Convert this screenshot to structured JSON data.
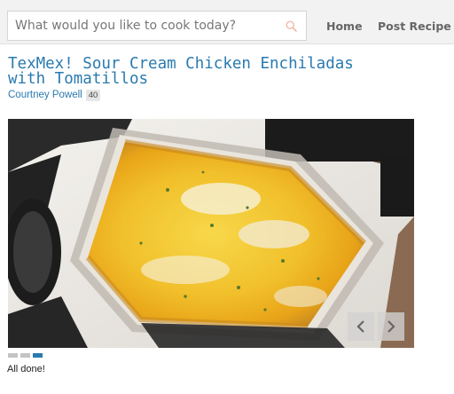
{
  "header": {
    "search": {
      "placeholder": "What would you like to cook today?",
      "value": ""
    },
    "nav": [
      {
        "label": "Home"
      },
      {
        "label": "Post Recipe"
      }
    ]
  },
  "recipe": {
    "title": "TexMex! Sour Cream Chicken Enchiladas with Tomatillos",
    "author": "Courtney Powell",
    "author_count": "40",
    "caption": "All done!"
  },
  "slideshow": {
    "slide_count": 3,
    "current_slide": 3
  },
  "colors": {
    "accent": "#2a7ab0",
    "topbar": "#f2f2f2",
    "badge": "#e6e6e6",
    "dot_inactive": "#c4c4c4"
  },
  "icons": {
    "search": "search-icon",
    "prev": "chevron-left-icon",
    "next": "chevron-right-icon"
  }
}
